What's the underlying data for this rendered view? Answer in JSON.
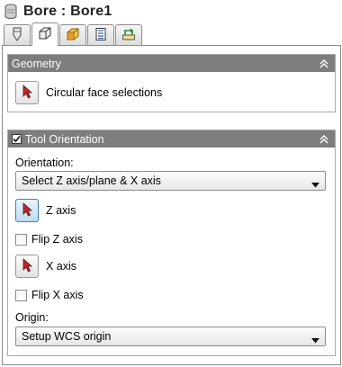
{
  "window": {
    "title": "Bore : Bore1"
  },
  "tabs": [
    {
      "icon": "tool-icon",
      "active": false
    },
    {
      "icon": "geometry-icon",
      "active": true
    },
    {
      "icon": "heights-icon",
      "active": false
    },
    {
      "icon": "passes-icon",
      "active": false
    },
    {
      "icon": "linking-icon",
      "active": false
    }
  ],
  "geometry": {
    "header": "Geometry",
    "circular_face": {
      "label": "Circular face selections",
      "icon": "arrow-pointer-icon"
    }
  },
  "tool_orientation": {
    "header": "Tool Orientation",
    "enabled": true,
    "orientation_label": "Orientation:",
    "orientation_value": "Select Z axis/plane & X axis",
    "z_axis_label": "Z axis",
    "flip_z_label": "Flip Z axis",
    "x_axis_label": "X axis",
    "flip_x_label": "Flip X axis",
    "origin_label": "Origin:",
    "origin_value": "Setup WCS origin"
  },
  "colors": {
    "section_header_bg": "#7d7d7d",
    "pointer_red": "#c0282d",
    "active_button_blue": "#bfdcf2"
  }
}
